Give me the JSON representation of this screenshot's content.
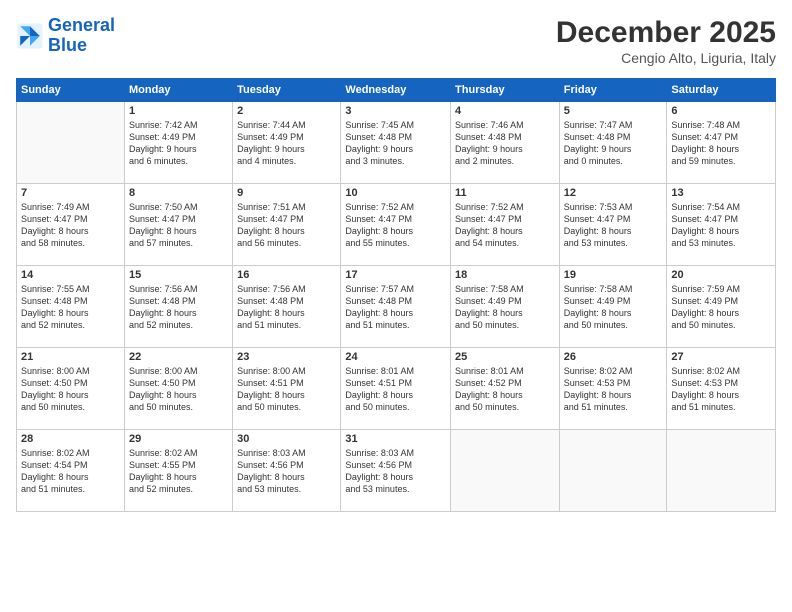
{
  "header": {
    "logo_line1": "General",
    "logo_line2": "Blue",
    "month": "December 2025",
    "location": "Cengio Alto, Liguria, Italy"
  },
  "weekdays": [
    "Sunday",
    "Monday",
    "Tuesday",
    "Wednesday",
    "Thursday",
    "Friday",
    "Saturday"
  ],
  "weeks": [
    [
      {
        "day": "",
        "detail": ""
      },
      {
        "day": "1",
        "detail": "Sunrise: 7:42 AM\nSunset: 4:49 PM\nDaylight: 9 hours\nand 6 minutes."
      },
      {
        "day": "2",
        "detail": "Sunrise: 7:44 AM\nSunset: 4:49 PM\nDaylight: 9 hours\nand 4 minutes."
      },
      {
        "day": "3",
        "detail": "Sunrise: 7:45 AM\nSunset: 4:48 PM\nDaylight: 9 hours\nand 3 minutes."
      },
      {
        "day": "4",
        "detail": "Sunrise: 7:46 AM\nSunset: 4:48 PM\nDaylight: 9 hours\nand 2 minutes."
      },
      {
        "day": "5",
        "detail": "Sunrise: 7:47 AM\nSunset: 4:48 PM\nDaylight: 9 hours\nand 0 minutes."
      },
      {
        "day": "6",
        "detail": "Sunrise: 7:48 AM\nSunset: 4:47 PM\nDaylight: 8 hours\nand 59 minutes."
      }
    ],
    [
      {
        "day": "7",
        "detail": "Sunrise: 7:49 AM\nSunset: 4:47 PM\nDaylight: 8 hours\nand 58 minutes."
      },
      {
        "day": "8",
        "detail": "Sunrise: 7:50 AM\nSunset: 4:47 PM\nDaylight: 8 hours\nand 57 minutes."
      },
      {
        "day": "9",
        "detail": "Sunrise: 7:51 AM\nSunset: 4:47 PM\nDaylight: 8 hours\nand 56 minutes."
      },
      {
        "day": "10",
        "detail": "Sunrise: 7:52 AM\nSunset: 4:47 PM\nDaylight: 8 hours\nand 55 minutes."
      },
      {
        "day": "11",
        "detail": "Sunrise: 7:52 AM\nSunset: 4:47 PM\nDaylight: 8 hours\nand 54 minutes."
      },
      {
        "day": "12",
        "detail": "Sunrise: 7:53 AM\nSunset: 4:47 PM\nDaylight: 8 hours\nand 53 minutes."
      },
      {
        "day": "13",
        "detail": "Sunrise: 7:54 AM\nSunset: 4:47 PM\nDaylight: 8 hours\nand 53 minutes."
      }
    ],
    [
      {
        "day": "14",
        "detail": "Sunrise: 7:55 AM\nSunset: 4:48 PM\nDaylight: 8 hours\nand 52 minutes."
      },
      {
        "day": "15",
        "detail": "Sunrise: 7:56 AM\nSunset: 4:48 PM\nDaylight: 8 hours\nand 52 minutes."
      },
      {
        "day": "16",
        "detail": "Sunrise: 7:56 AM\nSunset: 4:48 PM\nDaylight: 8 hours\nand 51 minutes."
      },
      {
        "day": "17",
        "detail": "Sunrise: 7:57 AM\nSunset: 4:48 PM\nDaylight: 8 hours\nand 51 minutes."
      },
      {
        "day": "18",
        "detail": "Sunrise: 7:58 AM\nSunset: 4:49 PM\nDaylight: 8 hours\nand 50 minutes."
      },
      {
        "day": "19",
        "detail": "Sunrise: 7:58 AM\nSunset: 4:49 PM\nDaylight: 8 hours\nand 50 minutes."
      },
      {
        "day": "20",
        "detail": "Sunrise: 7:59 AM\nSunset: 4:49 PM\nDaylight: 8 hours\nand 50 minutes."
      }
    ],
    [
      {
        "day": "21",
        "detail": "Sunrise: 8:00 AM\nSunset: 4:50 PM\nDaylight: 8 hours\nand 50 minutes."
      },
      {
        "day": "22",
        "detail": "Sunrise: 8:00 AM\nSunset: 4:50 PM\nDaylight: 8 hours\nand 50 minutes."
      },
      {
        "day": "23",
        "detail": "Sunrise: 8:00 AM\nSunset: 4:51 PM\nDaylight: 8 hours\nand 50 minutes."
      },
      {
        "day": "24",
        "detail": "Sunrise: 8:01 AM\nSunset: 4:51 PM\nDaylight: 8 hours\nand 50 minutes."
      },
      {
        "day": "25",
        "detail": "Sunrise: 8:01 AM\nSunset: 4:52 PM\nDaylight: 8 hours\nand 50 minutes."
      },
      {
        "day": "26",
        "detail": "Sunrise: 8:02 AM\nSunset: 4:53 PM\nDaylight: 8 hours\nand 51 minutes."
      },
      {
        "day": "27",
        "detail": "Sunrise: 8:02 AM\nSunset: 4:53 PM\nDaylight: 8 hours\nand 51 minutes."
      }
    ],
    [
      {
        "day": "28",
        "detail": "Sunrise: 8:02 AM\nSunset: 4:54 PM\nDaylight: 8 hours\nand 51 minutes."
      },
      {
        "day": "29",
        "detail": "Sunrise: 8:02 AM\nSunset: 4:55 PM\nDaylight: 8 hours\nand 52 minutes."
      },
      {
        "day": "30",
        "detail": "Sunrise: 8:03 AM\nSunset: 4:56 PM\nDaylight: 8 hours\nand 53 minutes."
      },
      {
        "day": "31",
        "detail": "Sunrise: 8:03 AM\nSunset: 4:56 PM\nDaylight: 8 hours\nand 53 minutes."
      },
      {
        "day": "",
        "detail": ""
      },
      {
        "day": "",
        "detail": ""
      },
      {
        "day": "",
        "detail": ""
      }
    ]
  ]
}
